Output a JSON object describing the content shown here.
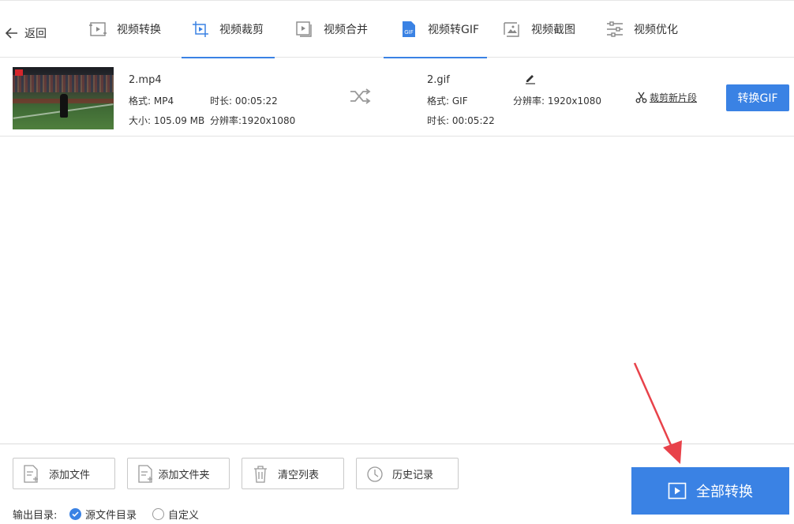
{
  "nav": {
    "back_label": "返回",
    "tabs": [
      {
        "label": "视频转换",
        "icon": "video-convert-icon"
      },
      {
        "label": "视频裁剪",
        "icon": "video-crop-icon"
      },
      {
        "label": "视频合并",
        "icon": "video-merge-icon"
      },
      {
        "label": "视频转GIF",
        "icon": "gif-icon",
        "badge": "GIF"
      },
      {
        "label": "视频截图",
        "icon": "image-icon"
      },
      {
        "label": "视频优化",
        "icon": "sliders-icon"
      }
    ]
  },
  "file": {
    "source_name": "2.mp4",
    "source_format": "格式: MP4",
    "source_duration": "时长: 00:05:22",
    "source_size": "大小: 105.09 MB",
    "source_resolution": "分辨率:1920x1080",
    "output_name": "2.gif",
    "output_format": "格式: GIF",
    "output_resolution": "分辨率: 1920x1080",
    "output_duration": "时长: 00:05:22",
    "cut_label": "裁剪新片段",
    "convert_button": "转换GIF"
  },
  "footer": {
    "add_file": "添加文件",
    "add_folder": "添加文件夹",
    "clear_list": "清空列表",
    "history": "历史记录",
    "output_dir_label": "输出目录:",
    "option_source": "源文件目录",
    "option_custom": "自定义",
    "convert_all": "全部转换"
  },
  "colors": {
    "accent": "#3a82e4",
    "annotation_arrow": "#e8424a"
  }
}
